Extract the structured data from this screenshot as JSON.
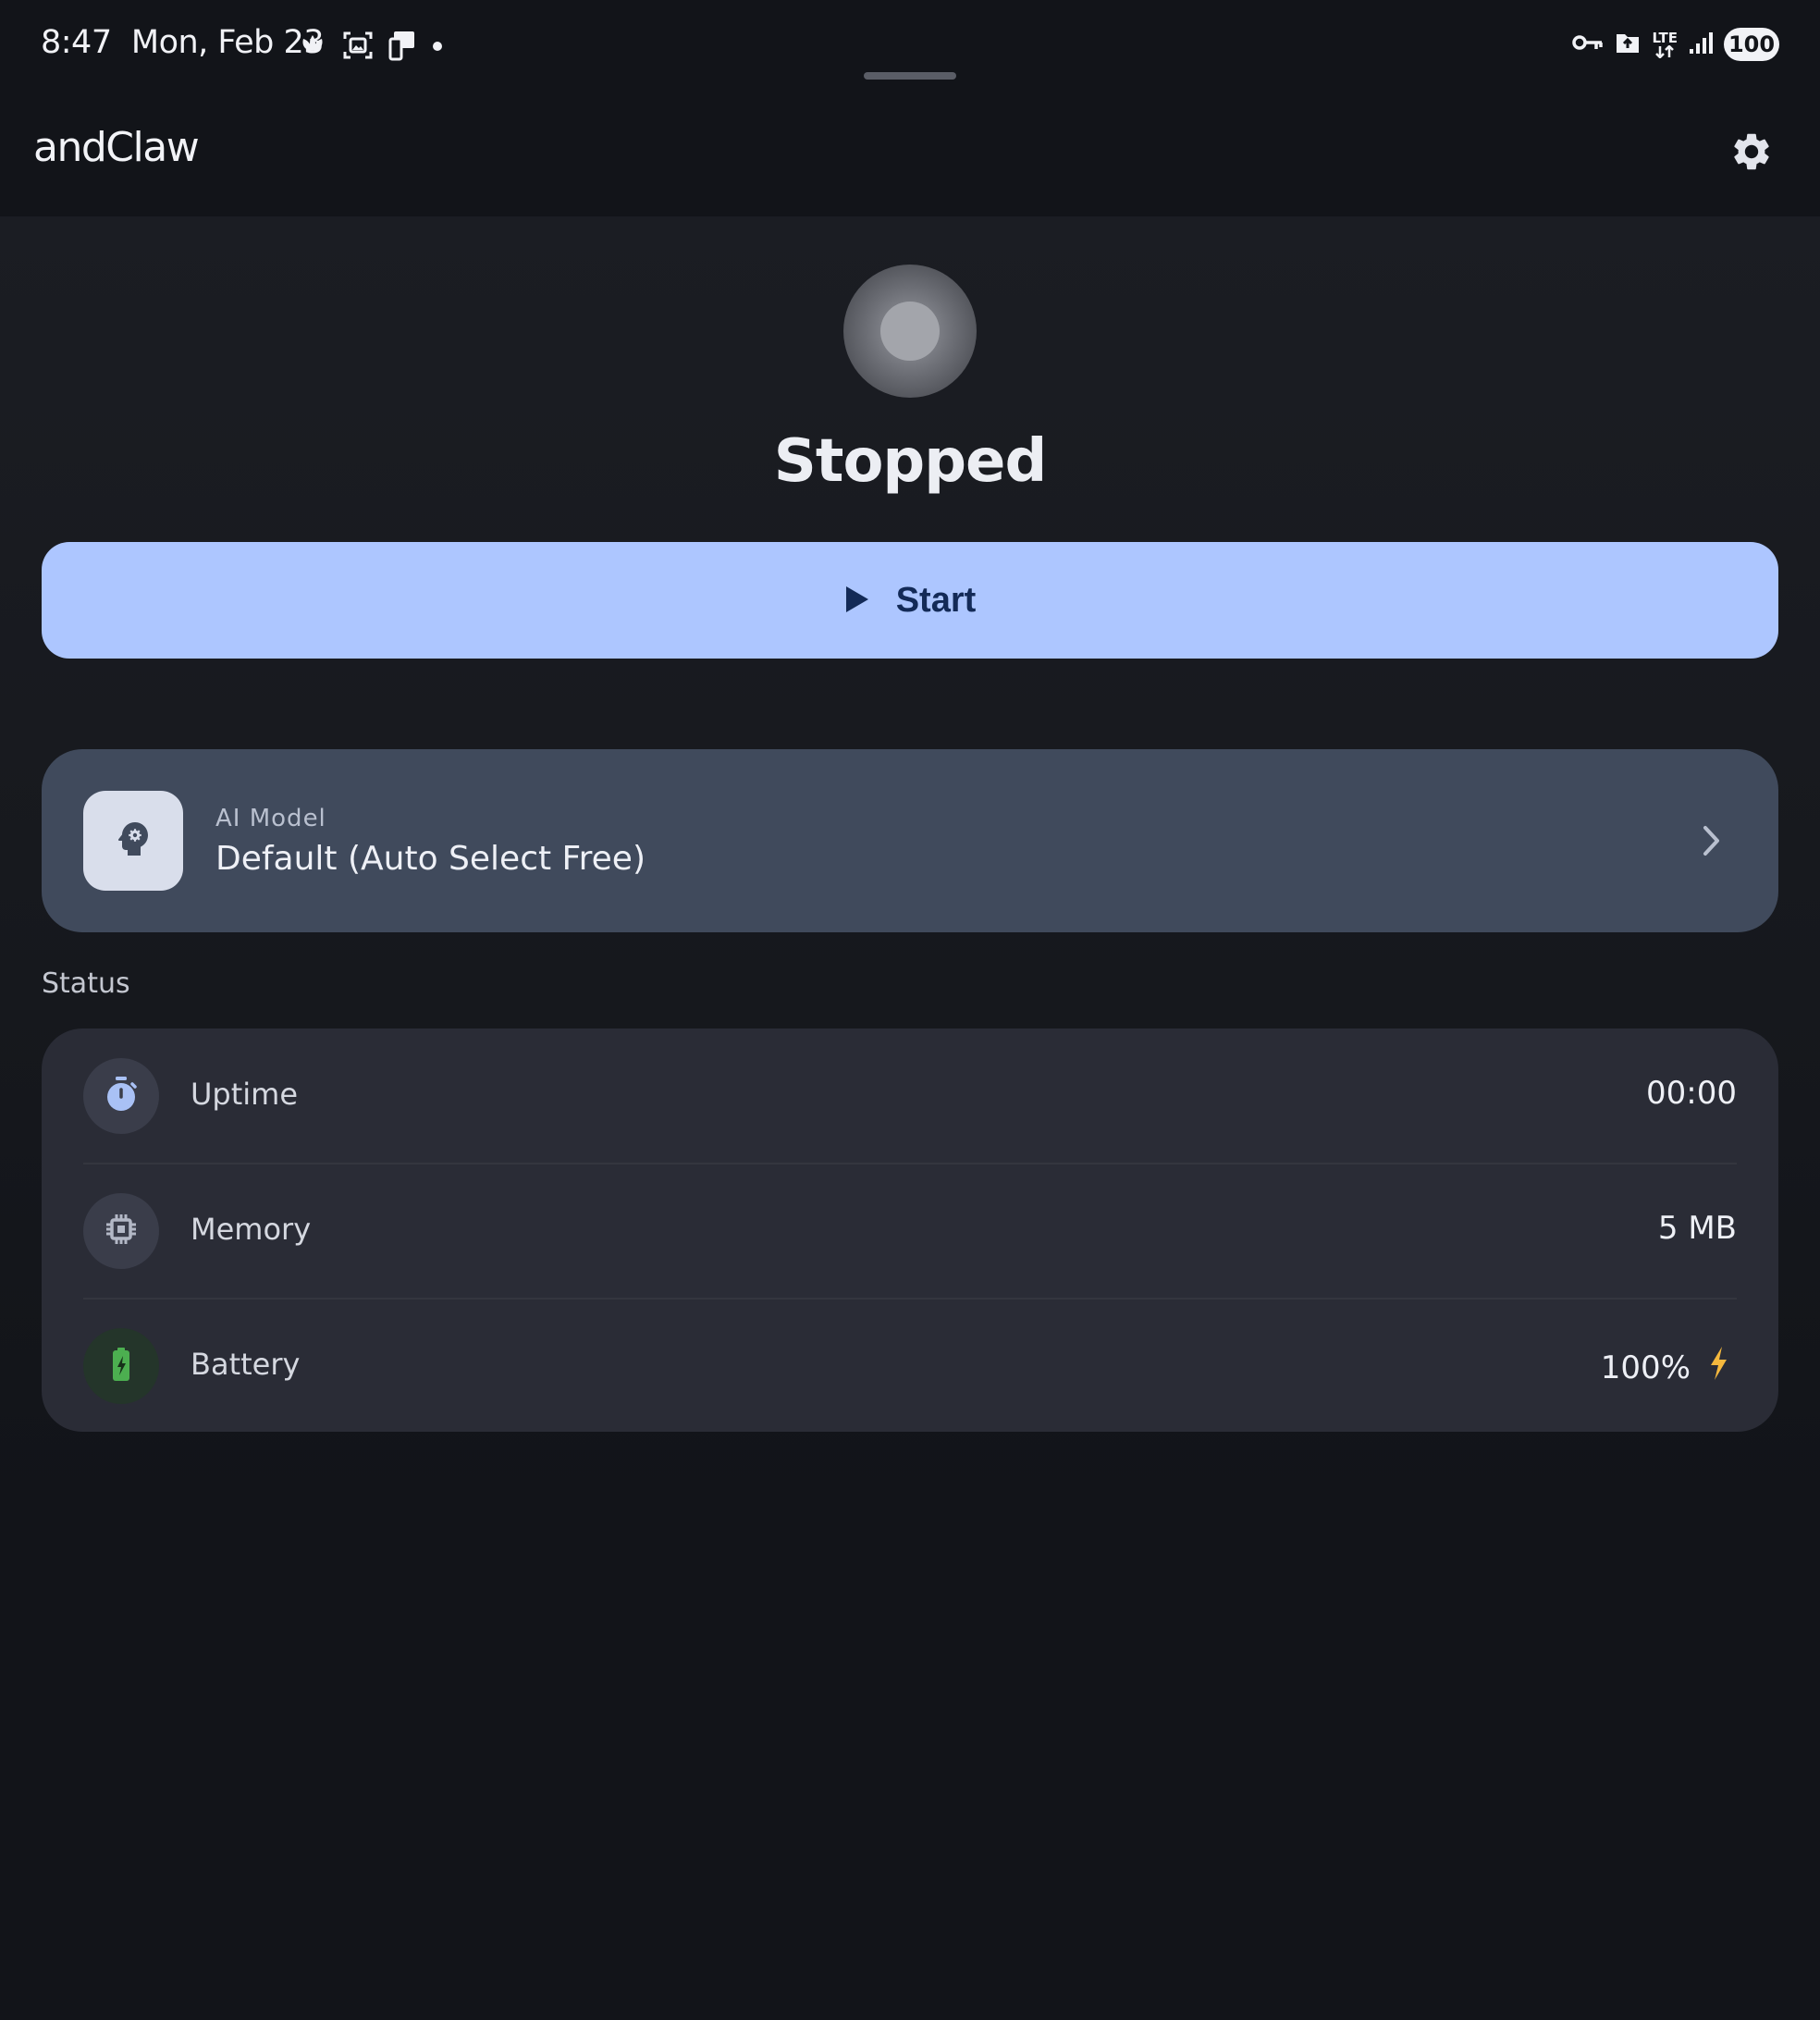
{
  "status_bar": {
    "time": "8:47",
    "date": "Mon, Feb 23",
    "network": "LTE",
    "battery_level": "100"
  },
  "app_bar": {
    "title": "andClaw",
    "settings_icon": "gear-icon"
  },
  "service": {
    "state": "Stopped",
    "start_label": "Start"
  },
  "model": {
    "label": "AI Model",
    "value": "Default (Auto Select Free)"
  },
  "status": {
    "section_title": "Status",
    "rows": [
      {
        "label": "Uptime",
        "value": "00:00",
        "icon": "timer-icon"
      },
      {
        "label": "Memory",
        "value": "5 MB",
        "icon": "chip-icon"
      },
      {
        "label": "Battery",
        "value": "100%",
        "icon": "battery-icon",
        "charging": true
      }
    ]
  },
  "colors": {
    "accent": "#adc6ff",
    "accent_text": "#132a57",
    "card": "#404a5c",
    "battery_green": "#4caf50",
    "charging_bolt": "#f5b83d"
  }
}
